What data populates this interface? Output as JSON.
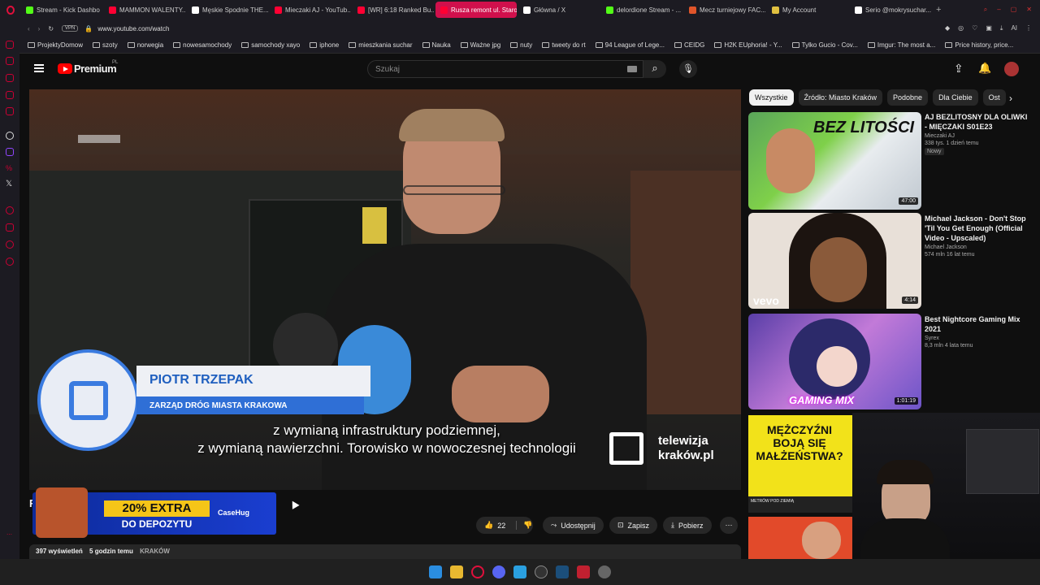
{
  "tabs": [
    {
      "title": "Stream - Kick Dashbo",
      "color": "#53fc18"
    },
    {
      "title": "MAMMON WALENTY...",
      "color": "#ff0033"
    },
    {
      "title": "Męskie Spodnie THE...",
      "color": "#ffffff"
    },
    {
      "title": "Mieczaki AJ - YouTub...",
      "color": "#ff0033"
    },
    {
      "title": "[WR] 6:18 Ranked Bu...",
      "color": "#ff0033"
    },
    {
      "title": "Rusza remont ul. Staro...",
      "color": "#ff0033",
      "active": true
    },
    {
      "title": "Główna / X",
      "color": "#ffffff"
    },
    {
      "title": "delordione Stream - ...",
      "color": "#53fc18"
    },
    {
      "title": "Mecz turniejowy FAC...",
      "color": "#e0552a"
    },
    {
      "title": "My Account",
      "color": "#e0c040"
    },
    {
      "title": "Serio @mokrysuchar...",
      "color": "#ffffff"
    }
  ],
  "address": {
    "vpn": "VPN",
    "url": "www.youtube.com/watch"
  },
  "bookmarks": [
    "ProjektyDomow",
    "szoty",
    "norwegia",
    "nowesamochody",
    "samochody xayo",
    "iphone",
    "mieszkania suchar",
    "Nauka",
    "Ważne jpg",
    "nuty",
    "tweety do rt",
    "94 League of Lege...",
    "CEIDG",
    "H2K EUphoria! - Y...",
    "Tylko Gucio - Cov...",
    "Imgur: The most a...",
    "Price history, price..."
  ],
  "youtube": {
    "logo": "Premium",
    "region": "PL",
    "search_placeholder": "Szukaj"
  },
  "video": {
    "lower_third_name": "PIOTR TRZEPAK",
    "lower_third_role": "ZARZĄD DRÓG MIASTA KRAKOWA",
    "subtitle_line1": "z wymianą infrastruktury podziemnej,",
    "subtitle_line2": "z wymianą nawierzchni. Torowisko w nowoczesnej technologii",
    "watermark_line1": "telewizja",
    "watermark_line2": "kraków.pl"
  },
  "promo": {
    "line1": "20% EXTRA",
    "line2": "DO DEPOZYTU",
    "brand": "CaseHug"
  },
  "title_stub": "R",
  "actions": {
    "likes": "22",
    "share": "Udostępnij",
    "save": "Zapisz",
    "download": "Pobierz"
  },
  "description": {
    "views": "397 wyświetleń",
    "age": "5 godzin temu",
    "tag": "KRAKÓW"
  },
  "chips": [
    "Wszystkie",
    "Źródło: Miasto Kraków",
    "Podobne",
    "Dla Ciebie",
    "Ost"
  ],
  "recommendations": [
    {
      "title": "AJ BEZLITOSNY DLA OLIWKI - MIĘCZAKI S01E23",
      "channel": "Mieczaki AJ",
      "meta": "338 tys.  1 dzień temu",
      "badge": "Nowy",
      "duration": "47:00",
      "thumb_text": "BEZ LITOŚCI"
    },
    {
      "title": "Michael Jackson - Don't Stop 'Til You Get Enough (Official Video - Upscaled)",
      "channel": "Michael Jackson",
      "meta": "574 mln  16 lat temu",
      "duration": "4:14",
      "thumb_text": "vevo"
    },
    {
      "title": "Best Nightcore Gaming Mix 2021",
      "channel": "Syrex",
      "meta": "8,3 mln  4 lata temu",
      "duration": "1:01:19",
      "thumb_text": "GAMING MIX"
    },
    {
      "thumb_text": "MĘŻCZYŹNI BOJĄ SIĘ MAŁŻEŃSTWA?",
      "tag": "METRÓW POD ZIEMIĄ"
    }
  ]
}
